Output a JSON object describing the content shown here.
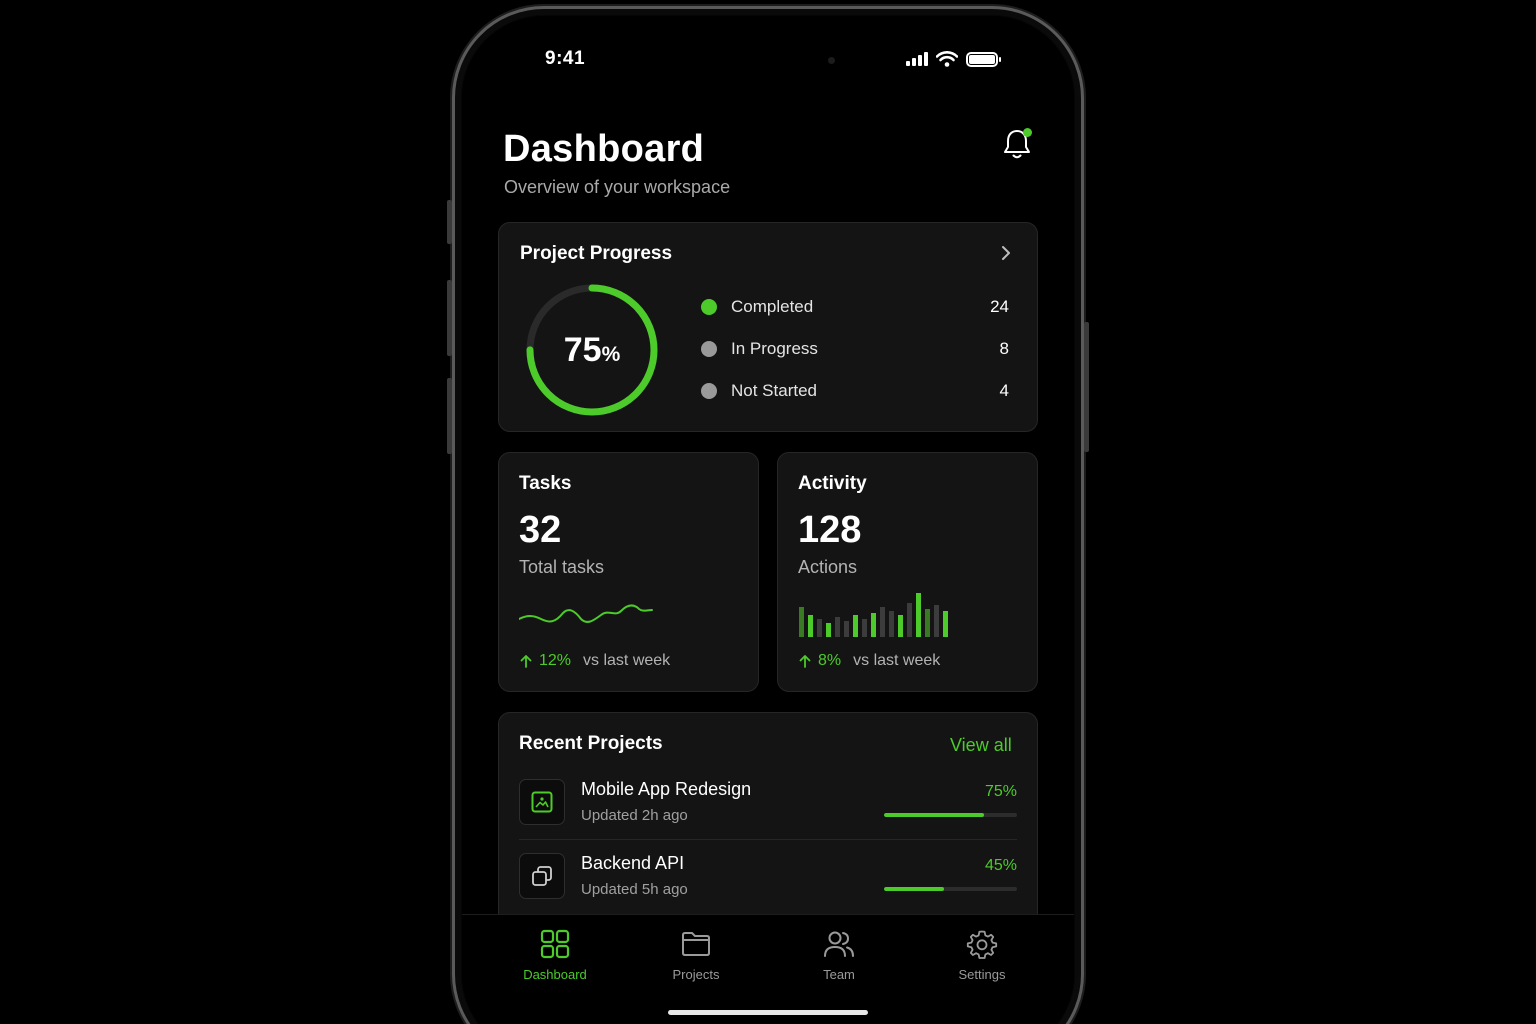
{
  "status_bar": {
    "time": "9:41"
  },
  "header": {
    "title": "Dashboard",
    "subtitle": "Overview of your workspace",
    "notification_icon": "bell-icon"
  },
  "project_progress": {
    "title": "Project Progress",
    "percent_value": "75",
    "percent_sign": "%",
    "progress": 0.75,
    "legend": [
      {
        "label": "Completed",
        "value": "24",
        "color": "#4ccb2a"
      },
      {
        "label": "In Progress",
        "value": "8",
        "color": "#9a9a9a"
      },
      {
        "label": "Not Started",
        "value": "4",
        "color": "#9a9a9a"
      }
    ]
  },
  "tasks": {
    "title": "Tasks",
    "value": "32",
    "subtitle": "Total tasks",
    "trend_pct": "12%",
    "trend_text": "vs last week"
  },
  "activity": {
    "title": "Activity",
    "value": "128",
    "subtitle": "Actions",
    "trend_pct": "8%",
    "trend_text": "vs last week"
  },
  "recent_projects": {
    "title": "Recent Projects",
    "view_all": "View all",
    "items": [
      {
        "name": "Mobile App Redesign",
        "updated": "Updated 2h ago",
        "percent": "75%",
        "progress": 0.75,
        "icon": "image-icon"
      },
      {
        "name": "Backend API",
        "updated": "Updated 5h ago",
        "percent": "45%",
        "progress": 0.45,
        "icon": "copy-icon"
      }
    ]
  },
  "tabbar": {
    "items": [
      {
        "label": "Dashboard",
        "icon": "grid-icon",
        "active": true
      },
      {
        "label": "Projects",
        "icon": "folder-icon",
        "active": false
      },
      {
        "label": "Team",
        "icon": "users-icon",
        "active": false
      },
      {
        "label": "Settings",
        "icon": "gear-icon",
        "active": false
      }
    ]
  },
  "colors": {
    "accent": "#4ccb2a",
    "card": "#141414",
    "muted": "#9a9a9a"
  }
}
